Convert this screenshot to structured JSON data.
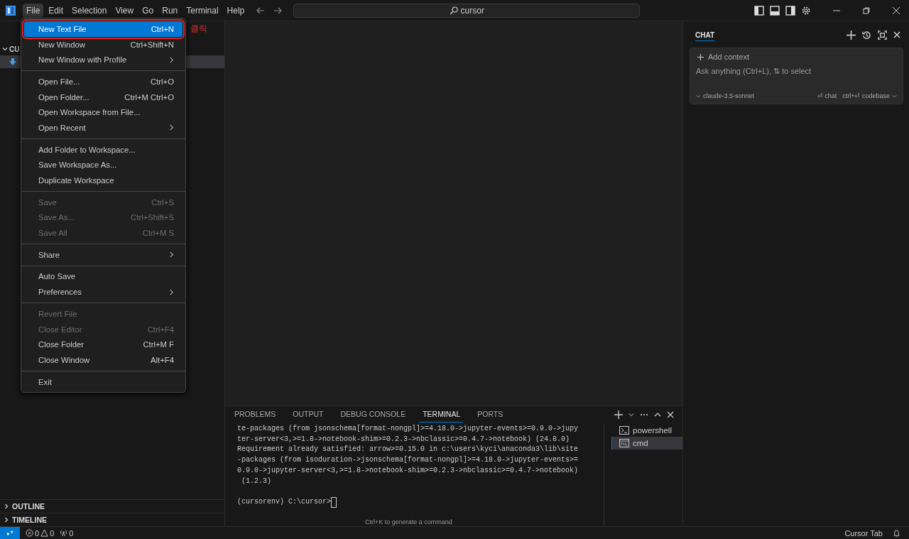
{
  "title_bar": {
    "menus": [
      {
        "label": "File",
        "selected": true
      },
      {
        "label": "Edit",
        "selected": false
      },
      {
        "label": "Selection",
        "selected": false
      },
      {
        "label": "View",
        "selected": false
      },
      {
        "label": "Go",
        "selected": false
      },
      {
        "label": "Run",
        "selected": false
      },
      {
        "label": "Terminal",
        "selected": false
      },
      {
        "label": "Help",
        "selected": false
      }
    ],
    "search": {
      "value": "cursor"
    }
  },
  "explorer": {
    "section": "CU",
    "expanded": true
  },
  "file_menu": {
    "annotation": "클릭",
    "groups": [
      [
        {
          "label": "New Text File",
          "shortcut": "Ctrl+N",
          "submenu": false,
          "disabled": false,
          "selected": true,
          "annotated": true
        },
        {
          "label": "New Window",
          "shortcut": "Ctrl+Shift+N",
          "submenu": false,
          "disabled": false,
          "selected": false,
          "annotated": false
        },
        {
          "label": "New Window with Profile",
          "submenu": true,
          "disabled": false,
          "selected": false,
          "annotated": false
        }
      ],
      [
        {
          "label": "Open File...",
          "shortcut": "Ctrl+O",
          "submenu": false,
          "disabled": false,
          "selected": false,
          "annotated": false
        },
        {
          "label": "Open Folder...",
          "shortcut": "Ctrl+M Ctrl+O",
          "submenu": false,
          "disabled": false,
          "selected": false,
          "annotated": false
        },
        {
          "label": "Open Workspace from File...",
          "submenu": false,
          "disabled": false,
          "selected": false,
          "annotated": false
        },
        {
          "label": "Open Recent",
          "submenu": true,
          "disabled": false,
          "selected": false,
          "annotated": false
        }
      ],
      [
        {
          "label": "Add Folder to Workspace...",
          "submenu": false,
          "disabled": false,
          "selected": false,
          "annotated": false
        },
        {
          "label": "Save Workspace As...",
          "submenu": false,
          "disabled": false,
          "selected": false,
          "annotated": false
        },
        {
          "label": "Duplicate Workspace",
          "submenu": false,
          "disabled": false,
          "selected": false,
          "annotated": false
        }
      ],
      [
        {
          "label": "Save",
          "shortcut": "Ctrl+S",
          "submenu": false,
          "disabled": true,
          "selected": false,
          "annotated": false
        },
        {
          "label": "Save As...",
          "shortcut": "Ctrl+Shift+S",
          "submenu": false,
          "disabled": true,
          "selected": false,
          "annotated": false
        },
        {
          "label": "Save All",
          "shortcut": "Ctrl+M S",
          "submenu": false,
          "disabled": true,
          "selected": false,
          "annotated": false
        }
      ],
      [
        {
          "label": "Share",
          "submenu": true,
          "disabled": false,
          "selected": false,
          "annotated": false
        }
      ],
      [
        {
          "label": "Auto Save",
          "submenu": false,
          "disabled": false,
          "selected": false,
          "annotated": false
        },
        {
          "label": "Preferences",
          "submenu": true,
          "disabled": false,
          "selected": false,
          "annotated": false
        }
      ],
      [
        {
          "label": "Revert File",
          "submenu": false,
          "disabled": true,
          "selected": false,
          "annotated": false
        },
        {
          "label": "Close Editor",
          "shortcut": "Ctrl+F4",
          "submenu": false,
          "disabled": true,
          "selected": false,
          "annotated": false
        },
        {
          "label": "Close Folder",
          "shortcut": "Ctrl+M F",
          "submenu": false,
          "disabled": false,
          "selected": false,
          "annotated": false
        },
        {
          "label": "Close Window",
          "shortcut": "Alt+F4",
          "submenu": false,
          "disabled": false,
          "selected": false,
          "annotated": false
        }
      ],
      [
        {
          "label": "Exit",
          "submenu": false,
          "disabled": false,
          "selected": false,
          "annotated": false
        }
      ]
    ]
  },
  "sidebar_sections": [
    {
      "label": "OUTLINE",
      "expanded": false
    },
    {
      "label": "TIMELINE",
      "expanded": false
    }
  ],
  "panel": {
    "tabs": [
      {
        "label": "PROBLEMS",
        "selected": false
      },
      {
        "label": "OUTPUT",
        "selected": false
      },
      {
        "label": "DEBUG CONSOLE",
        "selected": false
      },
      {
        "label": "TERMINAL",
        "selected": true
      },
      {
        "label": "PORTS",
        "selected": false
      }
    ],
    "terminal_lines": [
      "te-packages (from jsonschema[format-nongpl]>=4.18.0->jupyter-events>=0.9.0->jupy",
      "ter-server<3,>=1.8->notebook-shim>=0.2.3->nbclassic>=0.4.7->notebook) (24.8.0)",
      "Requirement already satisfied: arrow>=0.15.0 in c:\\users\\kyci\\anaconda3\\lib\\site",
      "-packages (from isoduration->jsonschema[format-nongpl]>=4.18.0->jupyter-events>=",
      "0.9.0->jupyter-server<3,>=1.8->notebook-shim>=0.2.3->nbclassic>=0.4.7->notebook)",
      " (1.2.3)"
    ],
    "prompt": "(cursorenv) C:\\cursor>",
    "hint": "Ctrl+K to generate a command",
    "terminals": [
      {
        "name": "powershell",
        "kind": "powershell",
        "selected": false
      },
      {
        "name": "cmd",
        "kind": "cmd",
        "selected": true
      }
    ]
  },
  "chat": {
    "title": "CHAT",
    "add_context": "Add context",
    "placeholder": "Ask anything (Ctrl+L), ⇅ to select",
    "model": "claude-3.5-sonnet",
    "chat_hint": "⏎ chat",
    "codebase_hint": "ctrl+⏎ codebase"
  },
  "status_bar": {
    "errors": "0",
    "warnings": "0",
    "ports": "0",
    "right": "Cursor Tab"
  }
}
